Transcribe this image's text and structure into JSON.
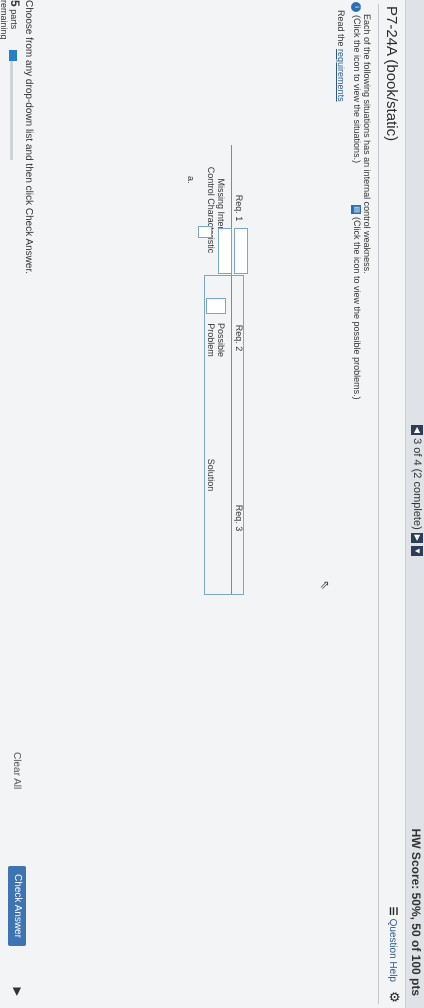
{
  "header": {
    "nav_text": "3 of 4 (2 complete)",
    "score_text": "HW Score: 50%, 50 of 100 pts"
  },
  "title": "P7-24A (book/static)",
  "toolbar": {
    "question_help": "Question Help"
  },
  "instructions": {
    "intro": "Each of the following situations has an internal control weakness.",
    "situations_note": "(Click the icon to view the situations.)",
    "problems_note": "(Click the icon to view the possible problems.)",
    "read_prefix": "Read the",
    "read_link": "requirements"
  },
  "table": {
    "groups": [
      "Req. 1",
      "Req. 2",
      "Req. 3"
    ],
    "columns": [
      {
        "line1": "Missing Internal",
        "line2": "Control Characteristic"
      },
      {
        "line1": "Possible",
        "line2": "Problem"
      },
      {
        "line1": "",
        "line2": "Solution"
      }
    ],
    "rows": [
      {
        "label": "a."
      }
    ]
  },
  "footer": {
    "hint": "Choose from any drop-down list and then click Check Answer.",
    "parts_count": "5",
    "parts_label_1": "parts",
    "parts_label_2": "remaining",
    "progress": 0.1,
    "clear_all": "Clear All",
    "check_answer": "Check Answer"
  },
  "colors": {
    "accent": "#3f74b3",
    "link": "#2a5b8f",
    "input_border": "#7aa7c7"
  }
}
